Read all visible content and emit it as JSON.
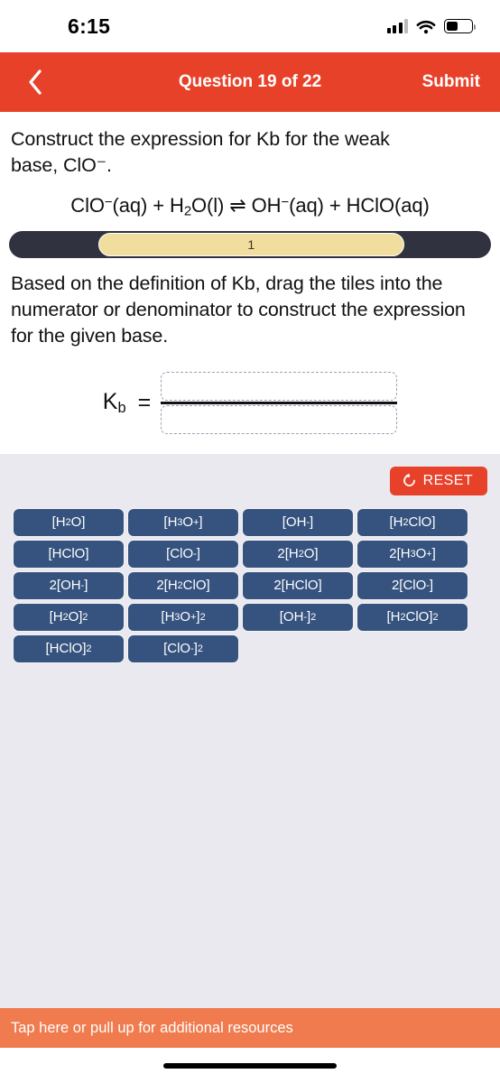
{
  "statusbar": {
    "time": "6:15",
    "signal_icon": "cellular-signal-icon",
    "wifi_icon": "wifi-icon",
    "battery_icon": "battery-icon"
  },
  "navbar": {
    "back_icon": "chevron-left-icon",
    "title": "Question 19 of 22",
    "submit_label": "Submit",
    "background_color": "#e8412a"
  },
  "question": {
    "prompt_line1": "Construct the expression for Kb for the weak",
    "prompt_line2": "base, ClO⁻.",
    "equation": "ClO⁻(aq) + H₂O(l) ⇌ OH⁻(aq) + HClO(aq)",
    "equation_parts": {
      "reactant1": "ClO⁻(aq)",
      "plus1": "+",
      "reactant2": "H₂O(l)",
      "arrow": "⇌",
      "product1": "OH⁻(aq)",
      "plus2": "+",
      "product2": "HClO(aq)"
    }
  },
  "progress": {
    "current_step": "1",
    "track_color": "#30333f",
    "fill_color": "#f1dd9e"
  },
  "instructions": {
    "text": "Based on the definition of Kb, drag the tiles into the numerator or denominator to construct the expression for the given base."
  },
  "fraction": {
    "label": "K",
    "label_sub": "b",
    "equals": "=",
    "numerator_value": "",
    "denominator_value": "",
    "numerator_placeholder": "",
    "denominator_placeholder": ""
  },
  "toolbar": {
    "reset_label": "RESET",
    "reset_icon": "reset-circular-arrow-icon",
    "reset_color": "#e8412a"
  },
  "tiles": {
    "color": "#35537e",
    "items": [
      {
        "html": "[H<sub>2</sub>O]",
        "text": "[H2O]"
      },
      {
        "html": "[H<sub>3</sub>O<sup>+</sup>]",
        "text": "[H3O+]"
      },
      {
        "html": "[OH<sup>-</sup>]",
        "text": "[OH-]"
      },
      {
        "html": "[H<sub>2</sub>ClO]",
        "text": "[H2ClO]"
      },
      {
        "html": "[HClO]",
        "text": "[HClO]"
      },
      {
        "html": "[ClO<sup>-</sup>]",
        "text": "[ClO-]"
      },
      {
        "html": "2[H<sub>2</sub>O]",
        "text": "2[H2O]"
      },
      {
        "html": "2[H<sub>3</sub>O<sup>+</sup>]",
        "text": "2[H3O+]"
      },
      {
        "html": "2[OH<sup>-</sup>]",
        "text": "2[OH-]"
      },
      {
        "html": "2[H<sub>2</sub>ClO]",
        "text": "2[H2ClO]"
      },
      {
        "html": "2[HClO]",
        "text": "2[HClO]"
      },
      {
        "html": "2[ClO<sup>-</sup>]",
        "text": "2[ClO-]"
      },
      {
        "html": "[H<sub>2</sub>O]<sup>2</sup>",
        "text": "[H2O]2"
      },
      {
        "html": "[H<sub>3</sub>O<sup>+</sup>]<sup>2</sup>",
        "text": "[H3O+]2"
      },
      {
        "html": "[OH<sup>-</sup>]<sup>2</sup>",
        "text": "[OH-]2"
      },
      {
        "html": "[H<sub>2</sub>ClO]<sup>2</sup>",
        "text": "[H2ClO]2"
      },
      {
        "html": "[HClO]<sup>2</sup>",
        "text": "[HClO]2"
      },
      {
        "html": "[ClO<sup>-</sup>]<sup>2</sup>",
        "text": "[ClO-]2"
      }
    ]
  },
  "resource_bar": {
    "text": "Tap here or pull up for additional resources",
    "background_color": "#ef7b4e"
  }
}
